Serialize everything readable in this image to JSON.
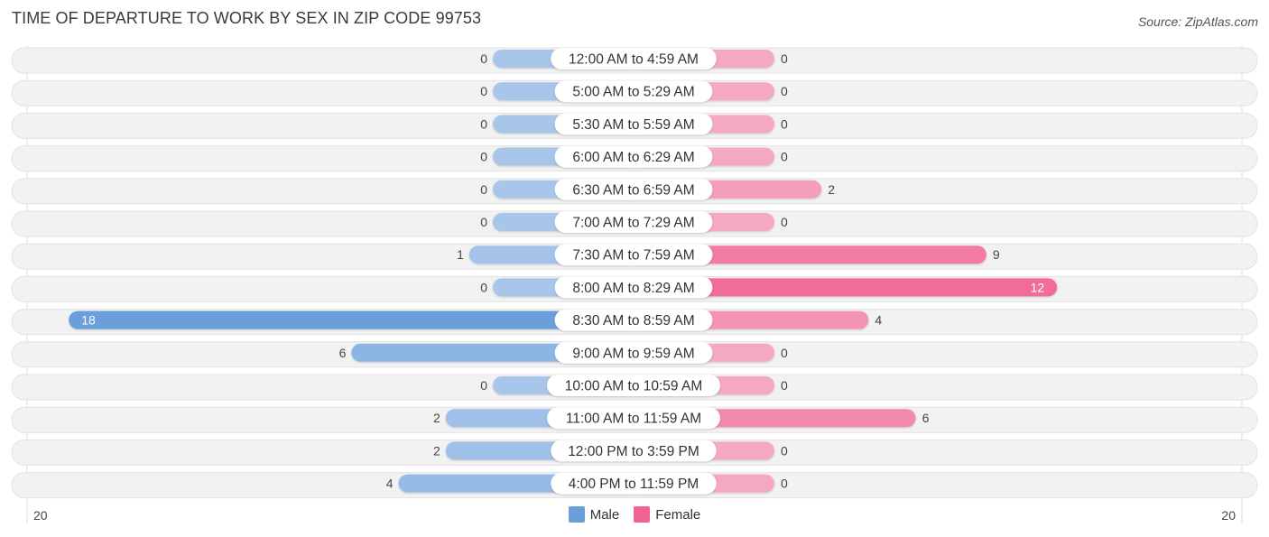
{
  "header": {
    "title": "TIME OF DEPARTURE TO WORK BY SEX IN ZIP CODE 99753",
    "source": "Source: ZipAtlas.com"
  },
  "colors": {
    "male": "#6a9fdc",
    "male_light": "#a8c6ea",
    "female": "#f06392",
    "female_light": "#f5a8c2",
    "row_bg": "#f2f2f2"
  },
  "legend": {
    "male_label": "Male",
    "female_label": "Female"
  },
  "axis": {
    "left_label": "20",
    "right_label": "20"
  },
  "chart_data": {
    "type": "bar",
    "orientation": "horizontal-diverging",
    "title": "TIME OF DEPARTURE TO WORK BY SEX IN ZIP CODE 99753",
    "xlabel": "",
    "ylabel": "",
    "xlim": [
      -20,
      20
    ],
    "legend_position": "bottom-center",
    "categories": [
      "12:00 AM to 4:59 AM",
      "5:00 AM to 5:29 AM",
      "5:30 AM to 5:59 AM",
      "6:00 AM to 6:29 AM",
      "6:30 AM to 6:59 AM",
      "7:00 AM to 7:29 AM",
      "7:30 AM to 7:59 AM",
      "8:00 AM to 8:29 AM",
      "8:30 AM to 8:59 AM",
      "9:00 AM to 9:59 AM",
      "10:00 AM to 10:59 AM",
      "11:00 AM to 11:59 AM",
      "12:00 PM to 3:59 PM",
      "4:00 PM to 11:59 PM"
    ],
    "series": [
      {
        "name": "Male",
        "values": [
          0,
          0,
          0,
          0,
          0,
          0,
          1,
          0,
          18,
          6,
          0,
          2,
          2,
          4
        ]
      },
      {
        "name": "Female",
        "values": [
          0,
          0,
          0,
          0,
          2,
          0,
          9,
          12,
          4,
          0,
          0,
          6,
          0,
          0
        ]
      }
    ]
  }
}
